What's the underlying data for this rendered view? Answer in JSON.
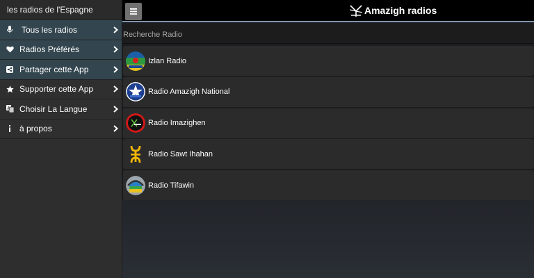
{
  "sidebar": {
    "title": "les radios de l'Espagne",
    "items": [
      {
        "label": "Tous les radios",
        "icon": "microphone-icon"
      },
      {
        "label": "Radios Préférés",
        "icon": "heart-icon"
      },
      {
        "label": "Partager cette App",
        "icon": "share-icon"
      },
      {
        "label": "Supporter cette App",
        "icon": "star-icon"
      },
      {
        "label": "Choisir La Langue",
        "icon": "translate-icon"
      },
      {
        "label": "à propos",
        "icon": "info-icon"
      }
    ]
  },
  "header": {
    "menu_icon": "hamburger-icon",
    "brand_text": "Amazigh radios",
    "brand_icon": "yaz-symbol-icon"
  },
  "search": {
    "placeholder": "Recherche Radio"
  },
  "stations": [
    {
      "name": "Izlan Radio",
      "logo": "izlan-logo"
    },
    {
      "name": "Radio Amazigh National",
      "logo": "amazigh-national-logo"
    },
    {
      "name": "Radio Imazighen",
      "logo": "imazighen-logo"
    },
    {
      "name": "Radio Sawt Ihahan",
      "logo": "sawt-ihahan-logo"
    },
    {
      "name": "Radio Tifawin",
      "logo": "tifawin-logo"
    }
  ],
  "colors": {
    "sidebar_bg": "#2e2e2e",
    "sidebar_active": "#33454e",
    "header_bg": "#000000",
    "header_rule": "#7f98ad",
    "row_bg": "#2b2b2b",
    "menu_button": "#707070"
  }
}
